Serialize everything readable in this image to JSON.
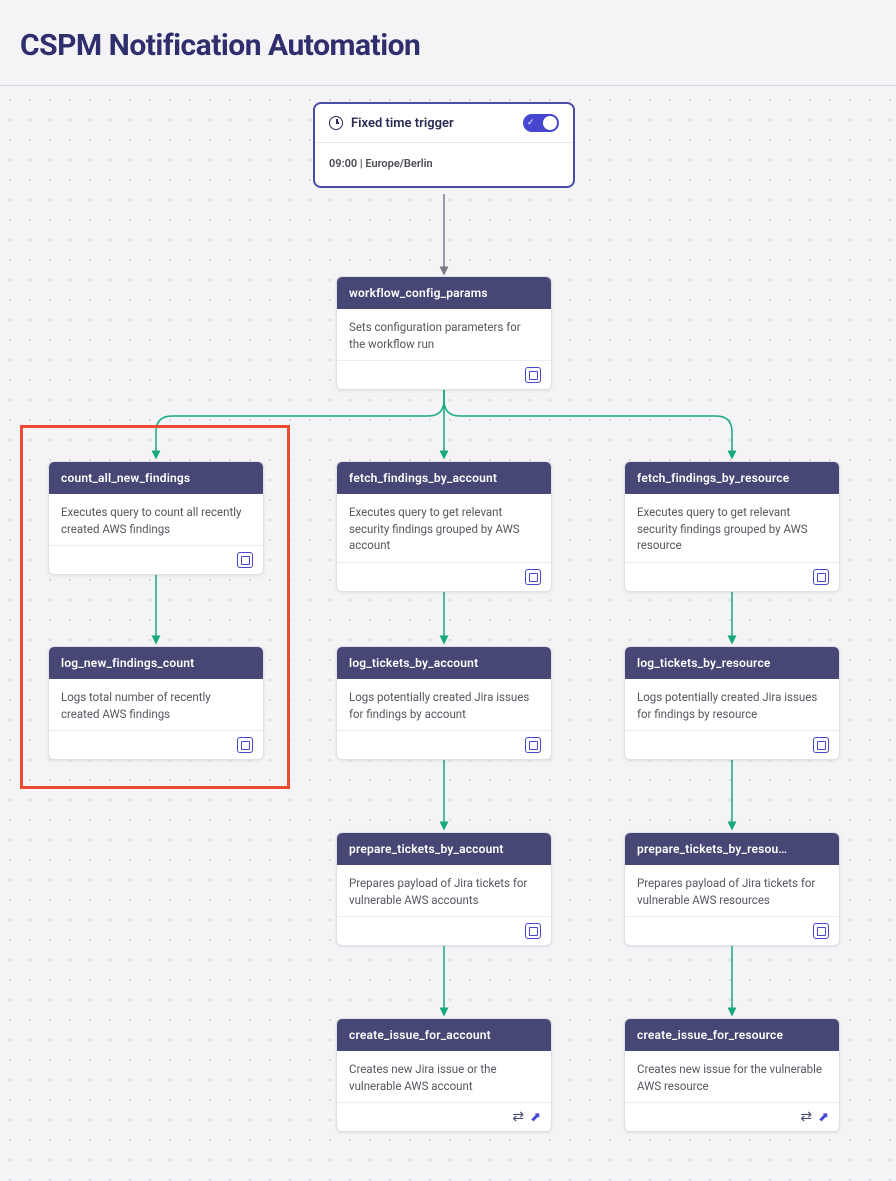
{
  "page": {
    "title": "CSPM Notification Automation"
  },
  "trigger": {
    "label": "Fixed time trigger",
    "schedule": "09:00 | Europe/Berlin"
  },
  "nodes": {
    "config": {
      "title": "workflow_config_params",
      "desc": "Sets configuration parameters for the workflow run"
    },
    "count_findings": {
      "title": "count_all_new_findings",
      "desc": "Executes query to count all recently created AWS findings"
    },
    "log_findings": {
      "title": "log_new_findings_count",
      "desc": "Logs total number of recently created AWS findings"
    },
    "fetch_by_account": {
      "title": "fetch_findings_by_account",
      "desc": "Executes query to get relevant security findings grouped by AWS account"
    },
    "log_by_account": {
      "title": "log_tickets_by_account",
      "desc": "Logs potentially created Jira issues for findings by account"
    },
    "prepare_by_account": {
      "title": "prepare_tickets_by_account",
      "desc": "Prepares payload of Jira tickets for vulnerable AWS accounts"
    },
    "create_by_account": {
      "title": "create_issue_for_account",
      "desc": "Creates new Jira issue or the vulnerable AWS account"
    },
    "fetch_by_resource": {
      "title": "fetch_findings_by_resource",
      "desc": "Executes query to get relevant security findings grouped by AWS resource"
    },
    "log_by_resource": {
      "title": "log_tickets_by_resource",
      "desc": "Logs potentially created Jira issues for findings by resource"
    },
    "prepare_by_resource": {
      "title": "prepare_tickets_by_resou…",
      "desc": "Prepares payload of Jira tickets for vulnerable AWS resources"
    },
    "create_by_resource": {
      "title": "create_issue_for_resource",
      "desc": "Creates new issue for the vulnerable AWS resource"
    }
  }
}
